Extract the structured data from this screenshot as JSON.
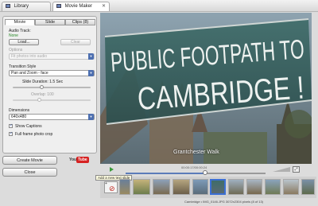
{
  "tabs": {
    "library": "Library",
    "movie_maker": "Movie Maker",
    "close_symbol": "✕"
  },
  "subtabs": [
    "Movie",
    "Slide",
    "Clips (8)"
  ],
  "audio": {
    "section_label": "Audio Track:",
    "status": "None",
    "load_label": "Load...",
    "clear_label": "Clear"
  },
  "options": {
    "label": "Options",
    "value": "Fit photos into audio"
  },
  "transition": {
    "label": "Transition Style",
    "value": "Pan and Zoom - face",
    "duration_label": "Slide Duration: 1.5 Sec",
    "duration_fraction": 0.38,
    "overlap_label": "Overlap: 100",
    "overlap_fraction": 0.35
  },
  "dimensions": {
    "label": "Dimensions",
    "value": "640x480"
  },
  "checkboxes": {
    "show_captions": "Show Captions",
    "full_frame": "Full frame photo crop"
  },
  "actions": {
    "create_movie": "Create Movie",
    "close": "Close",
    "youtube_you": "You",
    "youtube_tube": "Tube"
  },
  "preview": {
    "sign_line1": "PUBLIC FOOTPATH TO",
    "sign_line2": "CAMBRIDGE !",
    "caption": "Grantchester Walk",
    "timecode": "00:00:17/00:00:24",
    "playhead_fraction": 0.57
  },
  "tooltip": "Add a new text slide",
  "filmstrip": {
    "file_info": "Cambridge • IMG_0146.JPG   3072x2304 pixels   (8 of 13)"
  },
  "colors": {
    "accent": "#3b6fd4",
    "youtube_red": "#d62222",
    "status_green": "#2a8a2a"
  }
}
